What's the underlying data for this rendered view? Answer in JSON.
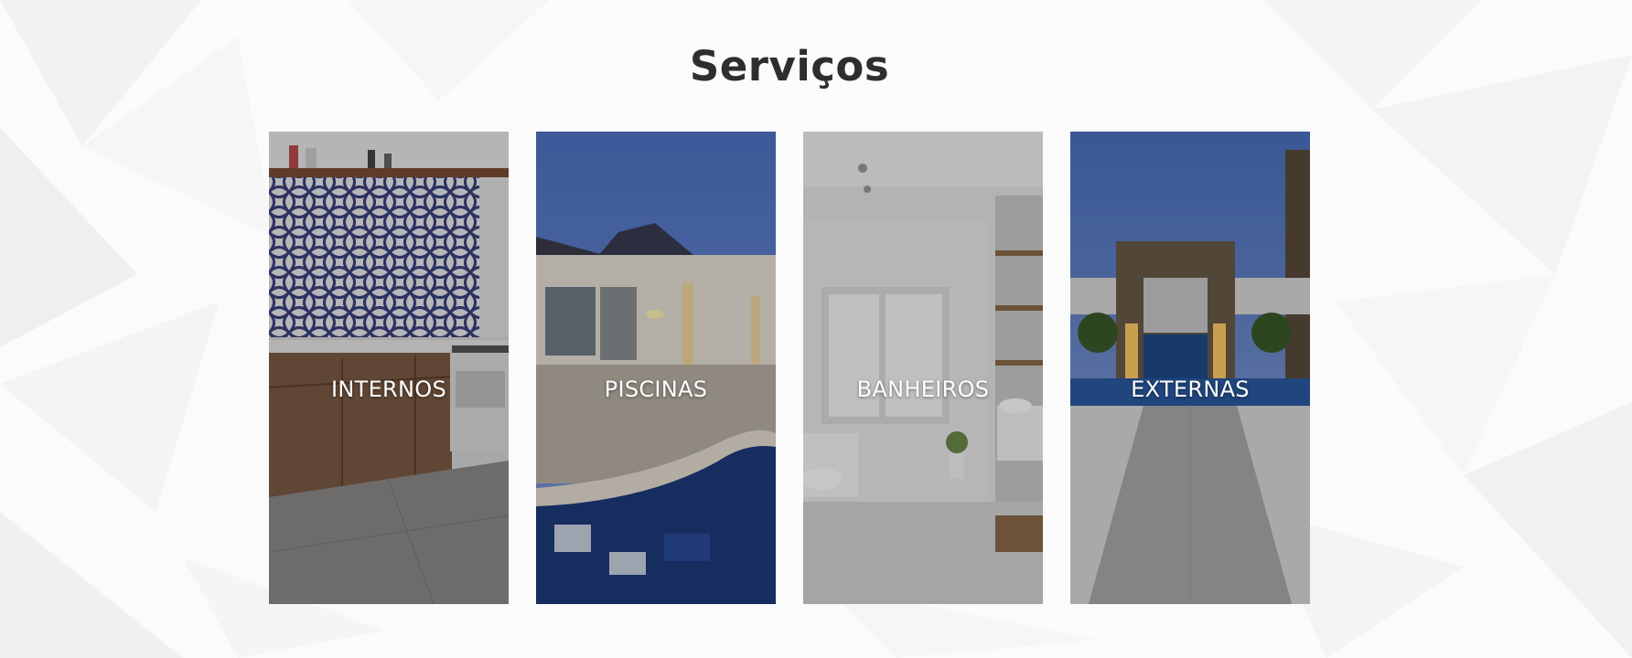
{
  "section": {
    "title": "Serviços"
  },
  "cards": [
    {
      "label": "INTERNOS",
      "image": "kitchen-interior"
    },
    {
      "label": "PISCINAS",
      "image": "pool-house"
    },
    {
      "label": "BANHEIROS",
      "image": "bathroom-interior"
    },
    {
      "label": "EXTERNAS",
      "image": "outdoor-fountain-walkway"
    }
  ],
  "colors": {
    "background": "#fbfbfb",
    "title": "#2e2e2e",
    "card_label": "#ffffff"
  }
}
